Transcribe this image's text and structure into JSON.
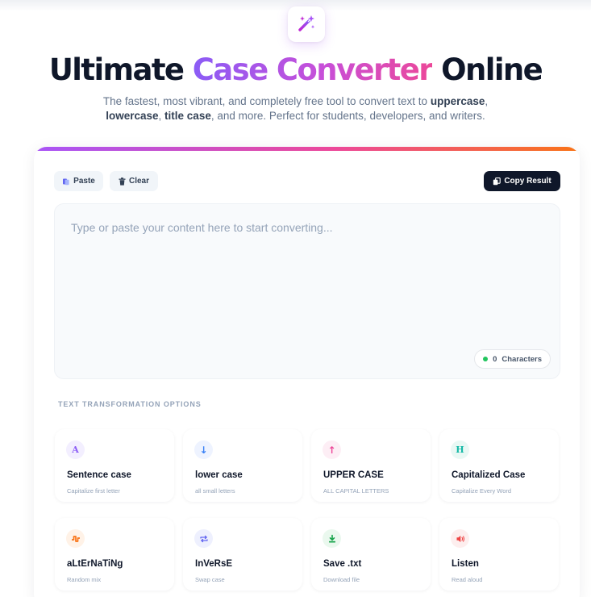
{
  "hero": {
    "title_part1": "Ultimate",
    "title_part2": "Case Converter",
    "title_part3": "Online",
    "subtitle_intro": "The fastest, most vibrant, and completely free tool to convert text to",
    "subtitle_kw1": "uppercase",
    "subtitle_sep1": ",",
    "subtitle_kw2": "lowercase",
    "subtitle_sep2": ",",
    "subtitle_kw3": "title case",
    "subtitle_outro": ", and more. Perfect for students, developers, and writers."
  },
  "toolbar": {
    "paste_label": "Paste",
    "clear_label": "Clear",
    "copy_label": "Copy Result"
  },
  "editor": {
    "placeholder": "Type or paste your content here to start converting...",
    "char_count": "0",
    "char_label": "Characters"
  },
  "options": {
    "section_label": "TEXT TRANSFORMATION OPTIONS",
    "items": [
      {
        "title": "Sentence case",
        "subtitle": "Capitalize first letter",
        "icon": "letter-a-icon",
        "glyph": "A",
        "color": "#8b5cf6",
        "bg": "#f3efff"
      },
      {
        "title": "lower case",
        "subtitle": "all small letters",
        "icon": "arrow-down-icon",
        "glyph": "↓",
        "color": "#3b82f6",
        "bg": "#eef3ff"
      },
      {
        "title": "UPPER CASE",
        "subtitle": "ALL CAPITAL LETTERS",
        "icon": "arrow-up-icon",
        "glyph": "↑",
        "color": "#ec4899",
        "bg": "#fdeef5"
      },
      {
        "title": "Capitalized Case",
        "subtitle": "Capitalize Every Word",
        "icon": "letter-h-icon",
        "glyph": "H",
        "color": "#14b8a6",
        "bg": "#e9f8f4"
      },
      {
        "title": "aLtErNaTiNg",
        "subtitle": "Random mix",
        "icon": "wave-icon",
        "glyph": "",
        "color": "#f97316",
        "bg": "#fff2e7"
      },
      {
        "title": "InVeRsE",
        "subtitle": "Swap case",
        "icon": "repeat-icon",
        "glyph": "",
        "color": "#6366f1",
        "bg": "#eef0fe"
      },
      {
        "title": "Save .txt",
        "subtitle": "Download file",
        "icon": "download-icon",
        "glyph": "",
        "color": "#16a34a",
        "bg": "#eaf8ee"
      },
      {
        "title": "Listen",
        "subtitle": "Read aloud",
        "icon": "speaker-icon",
        "glyph": "",
        "color": "#ef4444",
        "bg": "#fdeeee"
      }
    ]
  }
}
